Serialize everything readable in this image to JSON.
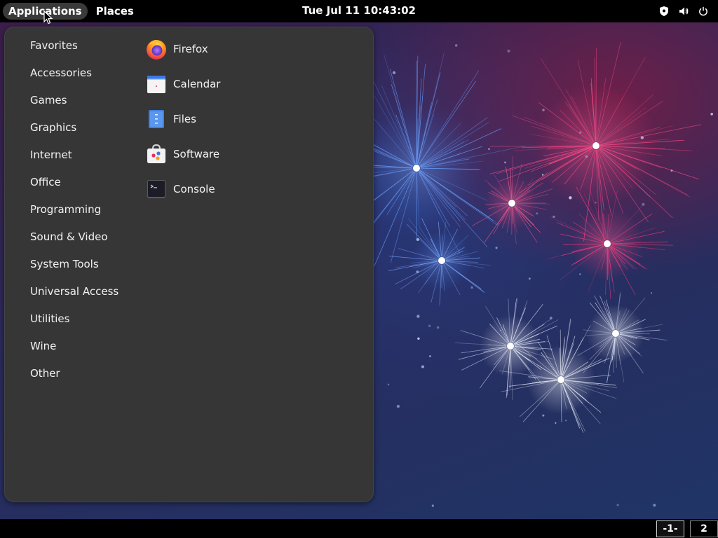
{
  "topbar": {
    "applications_label": "Applications",
    "places_label": "Places",
    "clock": "Tue Jul 11  10:43:02",
    "tray_icons": [
      "shield-icon",
      "volume-icon",
      "power-icon"
    ]
  },
  "menu": {
    "categories": [
      "Favorites",
      "Accessories",
      "Games",
      "Graphics",
      "Internet",
      "Office",
      "Programming",
      "Sound & Video",
      "System Tools",
      "Universal Access",
      "Utilities",
      "Wine",
      "Other"
    ],
    "apps": [
      {
        "label": "Firefox",
        "icon": "firefox-icon"
      },
      {
        "label": "Calendar",
        "icon": "calendar-icon"
      },
      {
        "label": "Files",
        "icon": "files-icon"
      },
      {
        "label": "Software",
        "icon": "software-icon"
      },
      {
        "label": "Console",
        "icon": "console-icon"
      }
    ]
  },
  "workspaces": [
    "-1-",
    "2"
  ],
  "colors": {
    "panel": "#000000",
    "menu_bg": "#363636",
    "accent_pink": "#e0306a",
    "accent_blue": "#4a78d8"
  }
}
